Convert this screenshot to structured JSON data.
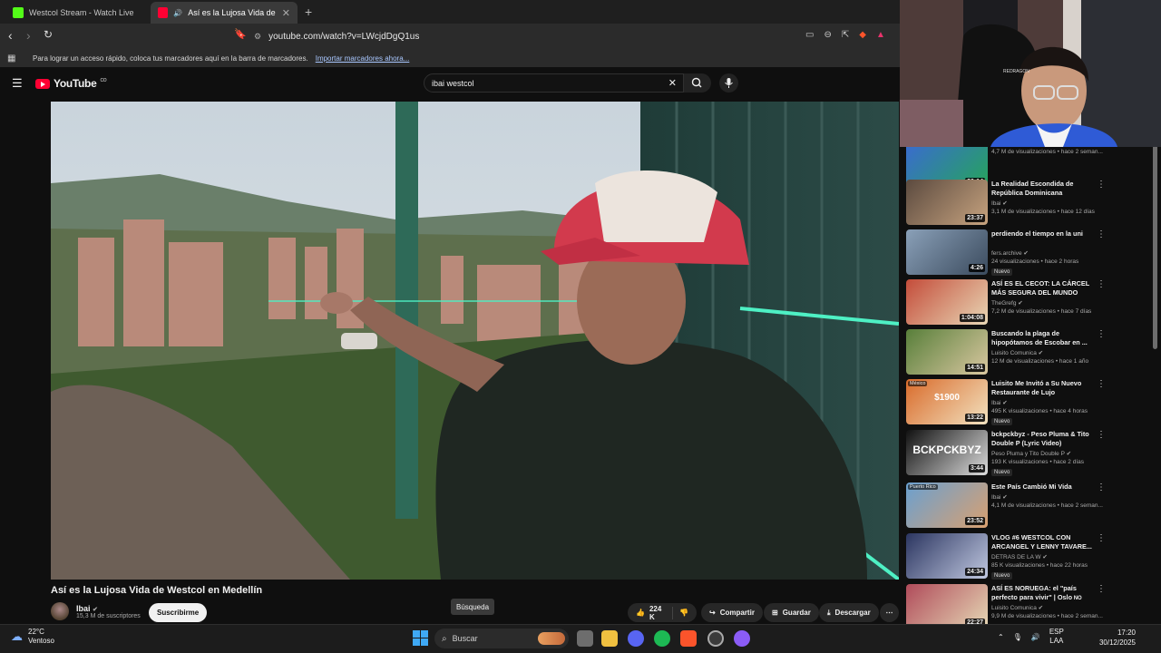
{
  "browser": {
    "tabs": [
      {
        "label": "Westcol Stream - Watch Live on K",
        "active": false
      },
      {
        "label": "Así es la Lujosa Vida de Westcol",
        "active": true
      }
    ],
    "new_tab": "+",
    "url": "youtube.com/watch?v=LWcjdDgQ1us",
    "bookmarks_hint": "Para lograr un acceso rápido, coloca tus marcadores aquí en la barra de marcadores.",
    "bookmarks_link": "Importar marcadores ahora..."
  },
  "youtube": {
    "logo": "YouTube",
    "logo_sup": "CO",
    "search_value": "ibai westcol",
    "video": {
      "title": "Así es la Lujosa Vida de Westcol en Medellín",
      "channel": "Ibai",
      "subscribers": "15,3 M de suscriptores",
      "subscribe_label": "Suscribirme",
      "likes": "224 K",
      "share": "Compartir",
      "save": "Guardar",
      "download": "Descargar",
      "tooltip": "Búsqueda"
    }
  },
  "recommendations": [
    {
      "title": "",
      "channel": "",
      "meta": "4,7 M de visualizaciones • hace 2 seman...",
      "duration": "20:14",
      "badge": ""
    },
    {
      "title": "La Realidad Escondida de República Dominicana",
      "channel": "Ibai",
      "meta": "3,1 M de visualizaciones • hace 12 días",
      "duration": "23:37",
      "badge": ""
    },
    {
      "title": "perdiendo el tiempo en la uni",
      "channel": "fers.archive",
      "meta": "24 visualizaciones • hace 2 horas",
      "duration": "4:26",
      "badge": "Nuevo"
    },
    {
      "title": "ASÍ ES EL CECOT: LA CÁRCEL MÁS SEGURA DEL MUNDO",
      "channel": "TheGrefg",
      "meta": "7,2 M de visualizaciones • hace 7 días",
      "duration": "1:04:08",
      "badge": ""
    },
    {
      "title": "Buscando la plaga de hipopótamos de Escobar en ...",
      "channel": "Luisito Comunica",
      "meta": "12 M de visualizaciones • hace 1 año",
      "duration": "14:51",
      "badge": ""
    },
    {
      "title": "Luisito Me Invitó a Su Nuevo Restaurante de Lujo",
      "channel": "Ibai",
      "meta": "495 K visualizaciones • hace 4 horas",
      "duration": "13:22",
      "badge": "Nuevo",
      "thumb_text": "$1900",
      "thumb_tag": "México"
    },
    {
      "title": "bckpckbyz - Peso Pluma & Tito Double P (Lyric Video)",
      "channel": "Peso Pluma y Tito Double P",
      "meta": "193 K visualizaciones • hace 2 días",
      "duration": "3:44",
      "badge": "Nuevo",
      "thumb_text": "BCKPCKBYZ"
    },
    {
      "title": "Este País Cambió Mi Vida",
      "channel": "Ibai",
      "meta": "4,1 M de visualizaciones • hace 2 seman...",
      "duration": "23:52",
      "badge": "",
      "thumb_tag": "Puerto Rico"
    },
    {
      "title": "VLOG #6 WESTCOL CON ARCANGEL Y LENNY TAVARE...",
      "channel": "DETRAS DE LA W",
      "meta": "85 K visualizaciones • hace 22 horas",
      "duration": "24:34",
      "badge": "Nuevo"
    },
    {
      "title": "ASÍ ES NORUEGA: el \"país perfecto para vivir\" | Oslo",
      "title_suffix": "NO",
      "channel": "Luisito Comunica",
      "meta": "9,9 M de visualizaciones • hace 2 seman...",
      "duration": "22:27",
      "badge": ""
    }
  ],
  "webcam": {
    "caption": "REDRAGON"
  },
  "taskbar": {
    "weather_temp": "22°C",
    "weather_desc": "Ventoso",
    "search_placeholder": "Buscar",
    "lang": "ESP",
    "lang_sub": "LAA",
    "time": "17:20",
    "date": "30/12/2025"
  },
  "colors": {
    "youtube_red": "#ff0033",
    "background": "#0f0f0f",
    "kick_green": "#53fc18",
    "brave_orange": "#fb542b"
  }
}
